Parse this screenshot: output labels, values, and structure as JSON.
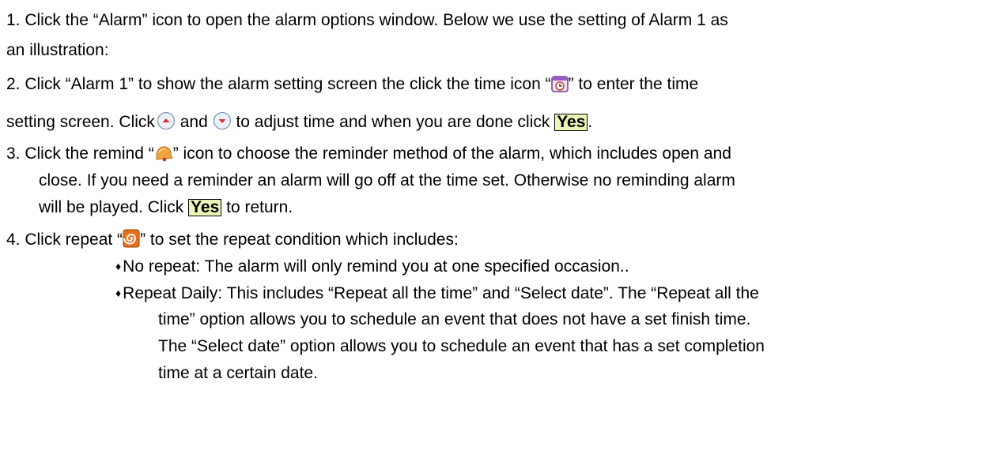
{
  "step1": {
    "line1": "1. Click the “Alarm” icon to open the alarm options window. Below we use the setting of Alarm 1 as",
    "line2": "an illustration:"
  },
  "step2": {
    "line1_a": "2. Click “Alarm 1” to show the alarm setting screen the click the time icon “",
    "line1_b": "” to enter the time",
    "line2_a": "setting screen. Click",
    "line2_b": " and ",
    "line2_c": " to adjust time and  when you are done click ",
    "line2_yes": "Yes",
    "line2_d": "."
  },
  "step3": {
    "line1_a": "3. Click the remind “",
    "line1_b": "” icon to choose the reminder method of the alarm, which includes open and",
    "line2": "close. If you need a reminder an alarm will go off at the time set. Otherwise no reminding alarm",
    "line3_a": "will be played. Click ",
    "line3_yes": "Yes",
    "line3_b": " to return."
  },
  "step4": {
    "line1_a": "4. Click repeat “",
    "line1_b": "” to set the repeat condition which includes:",
    "bullet_symbol": "♦",
    "bullet1": "No repeat: The alarm will only remind you at one specified occasion..",
    "bullet2_line1": "Repeat Daily: This includes “Repeat all the time” and “Select date”. The “Repeat all the",
    "bullet2_line2": "time” option allows you to schedule an event that does not have a set finish time.",
    "bullet2_line3": "The “Select date” option allows you to schedule an event that has a set completion",
    "bullet2_line4": "time at a certain date."
  },
  "icons": {
    "time": "clock-calendar-icon",
    "up": "up-arrow-button-icon",
    "down": "down-arrow-button-icon",
    "remind": "bell-icon",
    "repeat": "repeat-spiral-icon"
  },
  "colors": {
    "yes_background": "#e8f6b8",
    "arrow_red": "#d33030",
    "repeat_orange": "#e8701a"
  }
}
